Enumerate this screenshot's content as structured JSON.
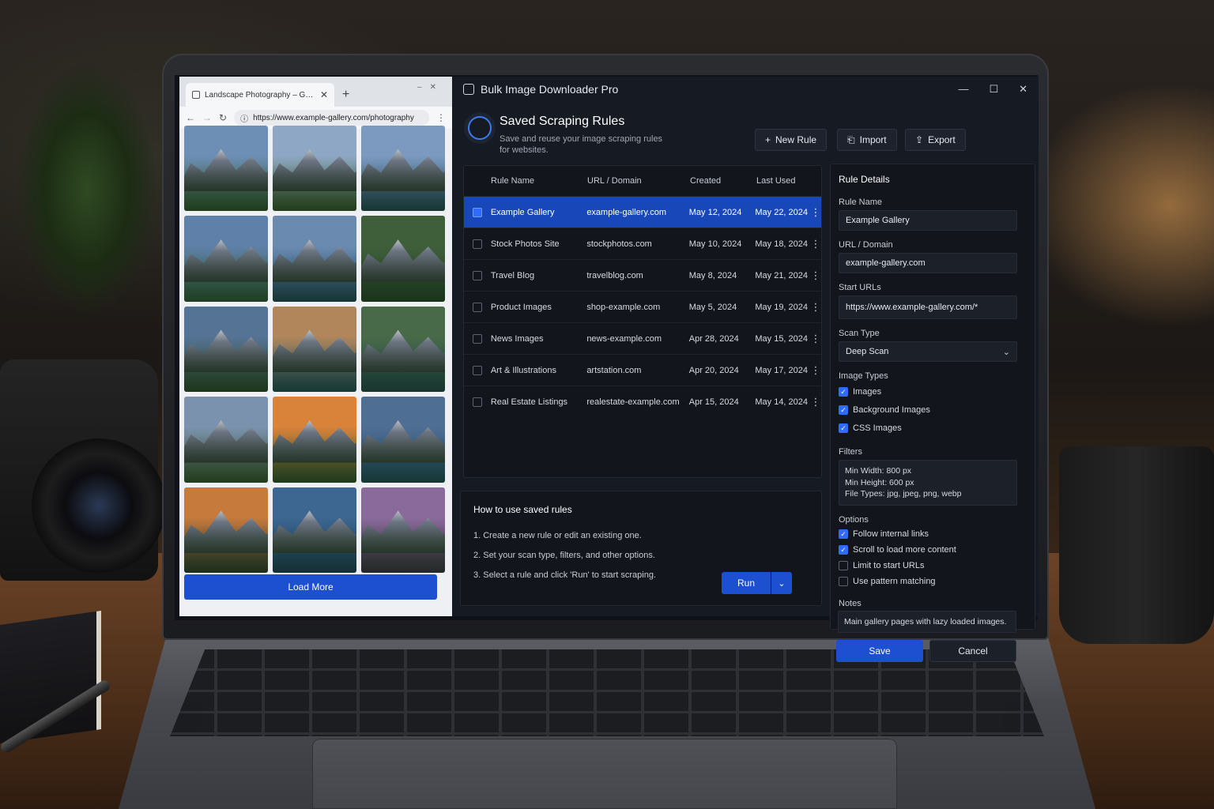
{
  "browser": {
    "tab_title": "Landscape Photography – Gallery",
    "url": "https://www.example-gallery.com/photography",
    "load_more_label": "Load More",
    "photos": [
      {
        "sky": "#6d8fb5",
        "ground": "#2f5a2a"
      },
      {
        "sky": "#8ea7c4",
        "ground": "#3a5c2b"
      },
      {
        "sky": "#7c9ac0",
        "ground": "#1f4a5e"
      },
      {
        "sky": "#5f80a8",
        "ground": "#2f5f3a"
      },
      {
        "sky": "#6b8ab0",
        "ground": "#1c4a68"
      },
      {
        "sky": "#3f5e3a",
        "ground": "#244626"
      },
      {
        "sky": "#557394",
        "ground": "#2c4b2a"
      },
      {
        "sky": "#b0865a",
        "ground": "#1c5266"
      },
      {
        "sky": "#486a48",
        "ground": "#1e4a52"
      },
      {
        "sky": "#7a92ae",
        "ground": "#3b5a30"
      },
      {
        "sky": "#d9823a",
        "ground": "#31562c"
      },
      {
        "sky": "#4f6e94",
        "ground": "#1b4d66"
      },
      {
        "sky": "#c67a3c",
        "ground": "#2a3a2a"
      },
      {
        "sky": "#3d6690",
        "ground": "#15405e"
      },
      {
        "sky": "#8a6a9a",
        "ground": "#3a2d40"
      }
    ]
  },
  "app": {
    "title": "Bulk Image Downloader Pro",
    "header": {
      "title": "Saved Scraping Rules",
      "subtitle": "Save and reuse your image scraping rules for websites."
    },
    "toolbar": {
      "new_rule": "New Rule",
      "import": "Import",
      "export": "Export"
    },
    "table": {
      "columns": {
        "name": "Rule Name",
        "url": "URL / Domain",
        "created": "Created",
        "last_used": "Last Used"
      },
      "rows": [
        {
          "name": "Example Gallery",
          "url": "example-gallery.com",
          "created": "May 12, 2024",
          "last_used": "May 22, 2024",
          "selected": true
        },
        {
          "name": "Stock Photos Site",
          "url": "stockphotos.com",
          "created": "May 10, 2024",
          "last_used": "May 18, 2024",
          "selected": false
        },
        {
          "name": "Travel Blog",
          "url": "travelblog.com",
          "created": "May 8, 2024",
          "last_used": "May 21, 2024",
          "selected": false
        },
        {
          "name": "Product Images",
          "url": "shop-example.com",
          "created": "May 5, 2024",
          "last_used": "May 19, 2024",
          "selected": false
        },
        {
          "name": "News Images",
          "url": "news-example.com",
          "created": "Apr 28, 2024",
          "last_used": "May 15, 2024",
          "selected": false
        },
        {
          "name": "Art & Illustrations",
          "url": "artstation.com",
          "created": "Apr 20, 2024",
          "last_used": "May 17, 2024",
          "selected": false
        },
        {
          "name": "Real Estate Listings",
          "url": "realestate-example.com",
          "created": "Apr 15, 2024",
          "last_used": "May 14, 2024",
          "selected": false
        }
      ]
    },
    "help": {
      "title": "How to use saved rules",
      "steps": [
        "1.   Create a new rule or edit an existing one.",
        "2.   Set your scan type, filters, and other options.",
        "3.   Select a rule and click 'Run' to start scraping."
      ],
      "run_label": "Run"
    },
    "details": {
      "title": "Rule Details",
      "rule_name_label": "Rule Name",
      "rule_name": "Example Gallery",
      "url_label": "URL / Domain",
      "url": "example-gallery.com",
      "start_urls_label": "Start URLs",
      "start_urls": "https://www.example-gallery.com/*",
      "scan_type_label": "Scan Type",
      "scan_type": "Deep Scan",
      "image_types_label": "Image Types",
      "image_types": [
        {
          "label": "Images",
          "checked": true
        },
        {
          "label": "Background Images",
          "checked": true
        },
        {
          "label": "CSS Images",
          "checked": true
        }
      ],
      "filters_label": "Filters",
      "filters": {
        "min_width": "Min Width: 800 px",
        "min_height": "Min Height: 600 px",
        "file_types": "File Types: jpg, jpeg, png, webp"
      },
      "options_label": "Options",
      "options": [
        {
          "label": "Follow internal links",
          "checked": true
        },
        {
          "label": "Scroll to load more content",
          "checked": true
        },
        {
          "label": "Limit to start URLs",
          "checked": false
        },
        {
          "label": "Use pattern matching",
          "checked": false
        }
      ],
      "notes_label": "Notes",
      "notes": "Main gallery pages with lazy loaded images.",
      "save_label": "Save",
      "cancel_label": "Cancel"
    }
  },
  "colors": {
    "accent": "#1d4fd1",
    "selected_row": "#1747b8",
    "panel": "#12151c",
    "window": "#161a22"
  }
}
